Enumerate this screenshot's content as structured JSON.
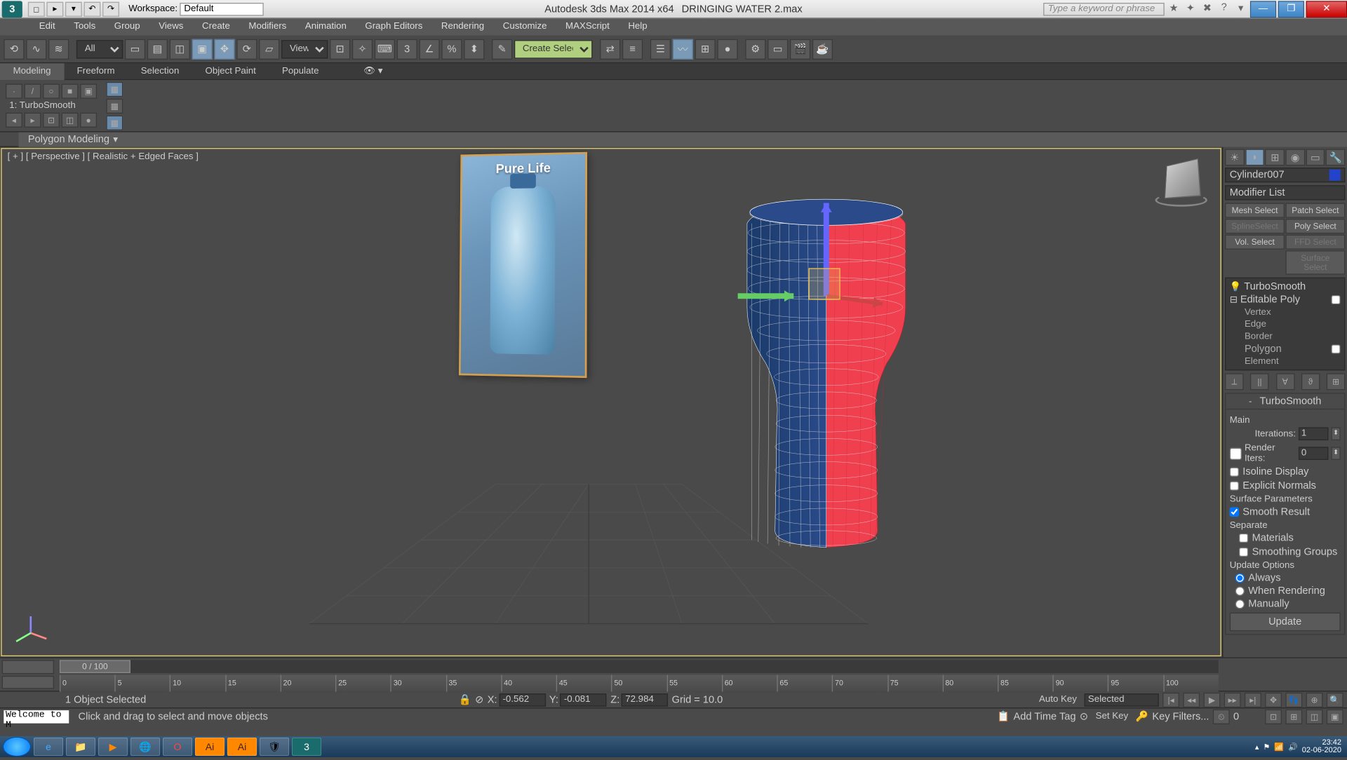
{
  "title": {
    "app": "Autodesk 3ds Max  2014 x64",
    "file": "DRINGING WATER 2.max",
    "workspace_label": "Workspace:",
    "workspace_value": "Default",
    "search_placeholder": "Type a keyword or phrase"
  },
  "menu": [
    "Edit",
    "Tools",
    "Group",
    "Views",
    "Create",
    "Modifiers",
    "Animation",
    "Graph Editors",
    "Rendering",
    "Customize",
    "MAXScript",
    "Help"
  ],
  "toolbar": {
    "sel_filter": "All",
    "ref_coord": "View",
    "named_sel": "Create Selection Se"
  },
  "ribbon": {
    "tabs": [
      "Modeling",
      "Freeform",
      "Selection",
      "Object Paint",
      "Populate"
    ],
    "obj_label": "1: TurboSmooth",
    "poly_modeling": "Polygon Modeling"
  },
  "viewport": {
    "label": "[ + ] [ Perspective ] [ Realistic + Edged Faces ]",
    "ref_text": "Pure Life"
  },
  "cmd": {
    "object_name": "Cylinder007",
    "modifier_list": "Modifier List",
    "sel_buttons": [
      "Mesh Select",
      "Patch Select",
      "SplineSelect",
      "Poly Select",
      "Vol. Select",
      "FFD Select",
      "Surface Select"
    ],
    "stack": {
      "top": "TurboSmooth",
      "base": "Editable Poly",
      "subs": [
        "Vertex",
        "Edge",
        "Border",
        "Polygon",
        "Element"
      ]
    },
    "rollout": {
      "title": "TurboSmooth",
      "main": "Main",
      "iterations_label": "Iterations:",
      "iterations_val": "1",
      "render_iters_label": "Render Iters:",
      "render_iters_val": "0",
      "isoline": "Isoline Display",
      "explicit": "Explicit Normals",
      "surf_params": "Surface Parameters",
      "smooth_result": "Smooth Result",
      "separate": "Separate",
      "materials": "Materials",
      "smoothing_groups": "Smoothing Groups",
      "update_options": "Update Options",
      "always": "Always",
      "when_rendering": "When Rendering",
      "manually": "Manually",
      "update_btn": "Update"
    }
  },
  "timeline": {
    "frame": "0 / 100",
    "ticks": [
      "0",
      "5",
      "10",
      "15",
      "20",
      "25",
      "30",
      "35",
      "40",
      "45",
      "50",
      "55",
      "60",
      "65",
      "70",
      "75",
      "80",
      "85",
      "90",
      "95",
      "100"
    ]
  },
  "status": {
    "selected": "1 Object Selected",
    "x_label": "X:",
    "x_val": "-0.562",
    "y_label": "Y:",
    "y_val": "-0.081",
    "z_label": "Z:",
    "z_val": "72.984",
    "grid": "Grid = 10.0",
    "add_time_tag": "Add Time Tag",
    "autokey": "Auto Key",
    "setkey": "Set Key",
    "sel_filter": "Selected",
    "key_filters": "Key Filters...",
    "prompt": "Welcome to M",
    "hint": "Click and drag to select and move objects"
  },
  "tray": {
    "time": "23:42",
    "date": "02-06-2020"
  }
}
